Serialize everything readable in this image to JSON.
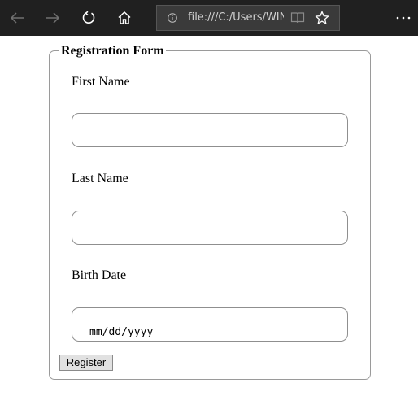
{
  "browser": {
    "url": "file:///C:/Users/WINI"
  },
  "form": {
    "legend": "Registration Form",
    "first_name_label": "First Name",
    "first_name_value": "",
    "last_name_label": "Last Name",
    "last_name_value": "",
    "birth_date_label": "Birth Date",
    "birth_date_placeholder": "mm/dd/yyyy",
    "register_label": "Register"
  },
  "icons": {
    "back": "back-arrow-icon",
    "forward": "forward-arrow-icon",
    "refresh": "refresh-icon",
    "home": "home-icon",
    "info": "info-icon",
    "reading_view": "reading-view-icon",
    "favorite": "star-icon",
    "more": "more-icon"
  },
  "colors": {
    "toolbar_bg": "#202020",
    "addressbar_bg": "#3a3a3a",
    "button_bg": "#e1e1e1"
  }
}
